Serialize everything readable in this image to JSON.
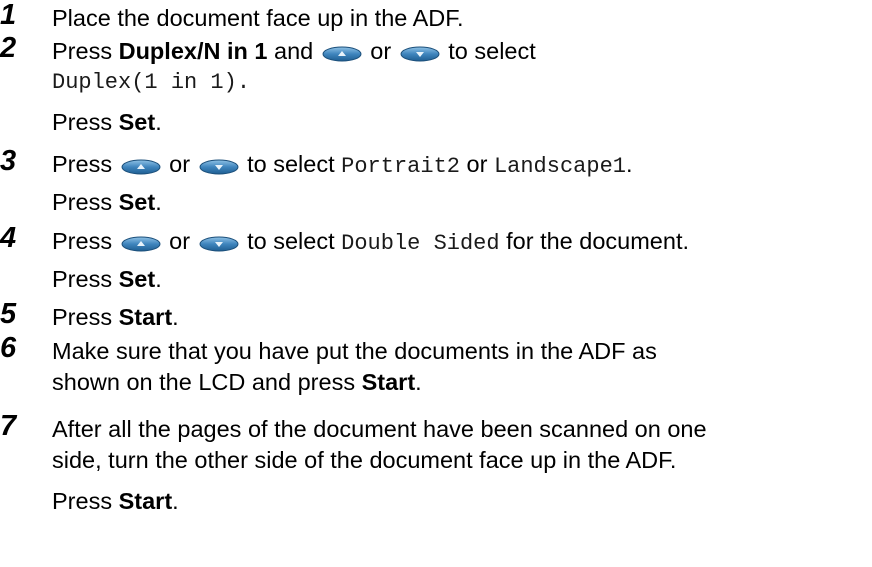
{
  "steps": [
    {
      "num": "1",
      "text": "Place the document face up in the ADF."
    },
    {
      "num": "2",
      "pre": "Press ",
      "key": "Duplex/N in 1",
      "mid1": " and ",
      "mid2": " or ",
      "post": " to select",
      "lcd": "Duplex(1 in 1).",
      "press": "Press ",
      "set": "Set",
      "end": "."
    },
    {
      "num": "3",
      "pre": "Press ",
      "or": " or ",
      "sel": " to select ",
      "lcd1": "Portrait2",
      "or2": " or ",
      "lcd2": "Landscape1",
      "end": ".",
      "press": "Press ",
      "set": "Set",
      "end2": "."
    },
    {
      "num": "4",
      "pre": "Press ",
      "or": " or ",
      "sel": " to select ",
      "lcd": "Double Sided",
      "post": " for the document.",
      "press": "Press ",
      "set": "Set",
      "end": "."
    },
    {
      "num": "5",
      "pre": "Press ",
      "key": "Start",
      "end": "."
    },
    {
      "num": "6",
      "line1": "Make sure that you have put the documents in the ADF as",
      "line2pre": "shown on the LCD and press ",
      "key": "Start",
      "end": "."
    },
    {
      "num": "7",
      "line1": "After all the pages of the document have been scanned on one",
      "line2": "side, turn the other side of the document face up in the ADF.",
      "press": "Press ",
      "key": "Start",
      "end": "."
    }
  ],
  "icons": {
    "up": "up-arrow-button-icon",
    "down": "down-arrow-button-icon",
    "color": "#2f6fa3"
  }
}
